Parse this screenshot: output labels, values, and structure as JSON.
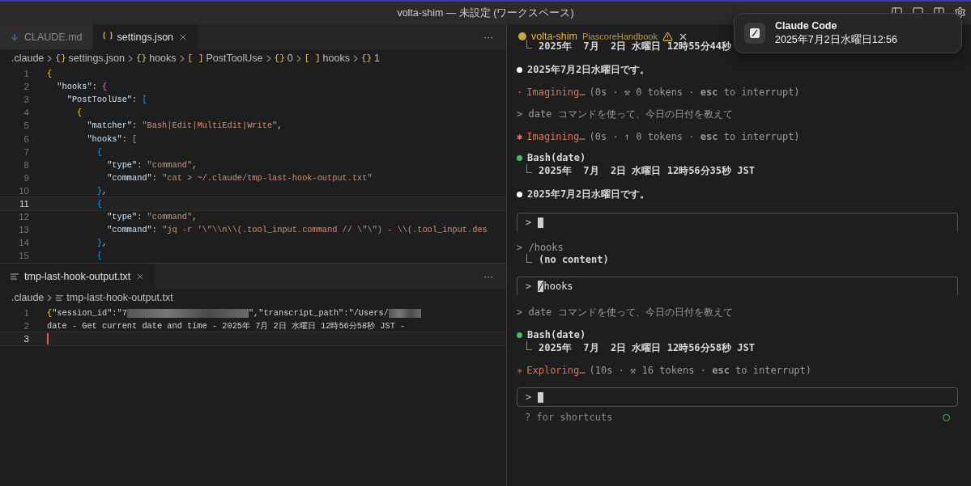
{
  "window": {
    "title": "volta-shim — 未設定 (ワークスペース)"
  },
  "editor": {
    "tabs": [
      {
        "label": "CLAUDE.md",
        "kind": "markdown",
        "selected": false
      },
      {
        "label": "settings.json",
        "kind": "json",
        "selected": true
      }
    ],
    "more": "···",
    "breadcrumb": [
      {
        "label": ".claude"
      },
      {
        "icon": "{}",
        "label": "settings.json"
      },
      {
        "icon": "{}",
        "label": "hooks"
      },
      {
        "icon": "[ ]",
        "label": "PostToolUse"
      },
      {
        "icon": "{}",
        "label": "0"
      },
      {
        "icon": "[ ]",
        "label": "hooks"
      },
      {
        "icon": "{}",
        "label": "1"
      }
    ],
    "lines": [
      {
        "number": "1",
        "current": false,
        "tokens": [
          {
            "kind": "brace1",
            "text": "{"
          }
        ]
      },
      {
        "number": "2",
        "current": false,
        "tokens": [
          {
            "kind": "key",
            "text": "  \"hooks\""
          },
          {
            "kind": "punct",
            "text": ": "
          },
          {
            "kind": "brace2",
            "text": "{"
          }
        ]
      },
      {
        "number": "3",
        "current": false,
        "tokens": [
          {
            "kind": "key",
            "text": "    \"PostToolUse\""
          },
          {
            "kind": "punct",
            "text": ": "
          },
          {
            "kind": "brace3",
            "text": "["
          }
        ]
      },
      {
        "number": "4",
        "current": false,
        "tokens": [
          {
            "kind": "brace1",
            "text": "      {"
          }
        ]
      },
      {
        "number": "5",
        "current": false,
        "tokens": [
          {
            "kind": "key",
            "text": "        \"matcher\""
          },
          {
            "kind": "punct",
            "text": ": "
          },
          {
            "kind": "string",
            "text": "\"Bash|Edit|MultiEdit|Write\""
          },
          {
            "kind": "punct",
            "text": ","
          }
        ]
      },
      {
        "number": "6",
        "current": false,
        "tokens": [
          {
            "kind": "key",
            "text": "        \"hooks\""
          },
          {
            "kind": "punct",
            "text": ": "
          },
          {
            "kind": "brace2",
            "text": "["
          }
        ]
      },
      {
        "number": "7",
        "current": false,
        "tokens": [
          {
            "kind": "brace3",
            "text": "          {"
          }
        ]
      },
      {
        "number": "8",
        "current": false,
        "tokens": [
          {
            "kind": "key",
            "text": "            \"type\""
          },
          {
            "kind": "punct",
            "text": ": "
          },
          {
            "kind": "string",
            "text": "\"command\""
          },
          {
            "kind": "punct",
            "text": ","
          }
        ]
      },
      {
        "number": "9",
        "current": false,
        "tokens": [
          {
            "kind": "key",
            "text": "            \"command\""
          },
          {
            "kind": "punct",
            "text": ": "
          },
          {
            "kind": "string",
            "text": "\"cat > ~/.claude/tmp-last-hook-output.txt\""
          }
        ]
      },
      {
        "number": "10",
        "current": false,
        "tokens": [
          {
            "kind": "brace3",
            "text": "          }"
          },
          {
            "kind": "punct",
            "text": ","
          }
        ]
      },
      {
        "number": "11",
        "current": true,
        "tokens": [
          {
            "kind": "brace3",
            "text": "          {"
          }
        ]
      },
      {
        "number": "12",
        "current": false,
        "tokens": [
          {
            "kind": "key",
            "text": "            \"type\""
          },
          {
            "kind": "punct",
            "text": ": "
          },
          {
            "kind": "string",
            "text": "\"command\""
          },
          {
            "kind": "punct",
            "text": ","
          }
        ]
      },
      {
        "number": "13",
        "current": false,
        "tokens": [
          {
            "kind": "key",
            "text": "            \"command\""
          },
          {
            "kind": "punct",
            "text": ": "
          },
          {
            "kind": "string",
            "text": "\"jq -r '\\\"\\\\n\\\\(.tool_input.command // \\\"\\\") - \\\\(.tool_input.des"
          }
        ]
      },
      {
        "number": "14",
        "current": false,
        "tokens": [
          {
            "kind": "brace3",
            "text": "          }"
          },
          {
            "kind": "punct",
            "text": ","
          }
        ]
      },
      {
        "number": "15",
        "current": false,
        "tokens": [
          {
            "kind": "brace3",
            "text": "          {"
          }
        ]
      }
    ]
  },
  "output_editor": {
    "tabs": [
      {
        "label": "tmp-last-hook-output.txt",
        "kind": "text",
        "selected": true
      }
    ],
    "more": "···",
    "breadcrumb": [
      {
        "label": ".claude"
      },
      {
        "label": "tmp-last-hook-output.txt",
        "kind": "text"
      }
    ],
    "lines": [
      {
        "number": "1",
        "current": false,
        "tokens": [
          {
            "kind": "brace1",
            "text": "{"
          },
          {
            "kind": "plain",
            "text": "\"session_id\":\"7"
          },
          {
            "kind": "redacted"
          },
          {
            "kind": "plain",
            "text": "\",\"transcript_path\":\"/Users/"
          },
          {
            "kind": "redacted-short"
          }
        ]
      },
      {
        "number": "2",
        "current": false,
        "tokens": [
          {
            "kind": "plain",
            "text": "date - Get current date and time - 2025年 7月 2日 水曜日 12時56分58秒 JST -"
          }
        ]
      },
      {
        "number": "3",
        "current": true
      }
    ]
  },
  "terminal": {
    "tab": {
      "name": "volta-shim",
      "project": "PiascoreHandbook"
    },
    "entries": [
      {
        "kind": "output",
        "text": "2025年  7月  2日 水曜日 12時55分44秒"
      },
      {
        "kind": "message",
        "color": "#ffffff",
        "text": "2025年7月2日水曜日です。"
      },
      {
        "kind": "status",
        "glyph": "·",
        "verb": "Imagining…",
        "detail": "(0s · ⚒ 0 tokens · **esc** to interrupt)"
      },
      {
        "kind": "prompt",
        "text": "> date コマンドを使って、今日の日付を教えて"
      },
      {
        "kind": "status",
        "glyph": "✱",
        "verb": "Imagining…",
        "detail": "(0s · ↑ 0 tokens · **esc** to interrupt)"
      },
      {
        "kind": "message",
        "color": "#4eba65",
        "text": "**Bash**(date)"
      },
      {
        "kind": "output",
        "text": "2025年  7月  2日 水曜日 12時56分35秒 JST"
      },
      {
        "kind": "message",
        "color": "#ffffff",
        "text": "2025年7月2日水曜日です。"
      },
      {
        "kind": "input",
        "prompt": ">",
        "cursor": true,
        "closed": false
      },
      {
        "kind": "prompt",
        "text": "> /hooks"
      },
      {
        "kind": "output",
        "text": "(no content)"
      },
      {
        "kind": "input",
        "prompt": ">",
        "value": "/hooks",
        "cursor": true,
        "closed": false
      },
      {
        "kind": "prompt",
        "text": "> date コマンドを使って、今日の日付を教えて"
      },
      {
        "kind": "message",
        "color": "#4eba65",
        "text": "**Bash**(date)"
      },
      {
        "kind": "output",
        "text": "2025年  7月  2日 水曜日 12時56分58秒 JST"
      },
      {
        "kind": "status",
        "glyph": "✳",
        "verb": "Exploring…",
        "detail": "(10s · ⚒ 16 tokens · **esc** to interrupt)"
      },
      {
        "kind": "input",
        "prompt": ">",
        "cursor": true,
        "closed": true
      },
      {
        "kind": "hint",
        "text": "? for shortcuts"
      }
    ]
  },
  "notification": {
    "title": "Claude Code",
    "body": "2025年7月2日水曜日12:56"
  }
}
